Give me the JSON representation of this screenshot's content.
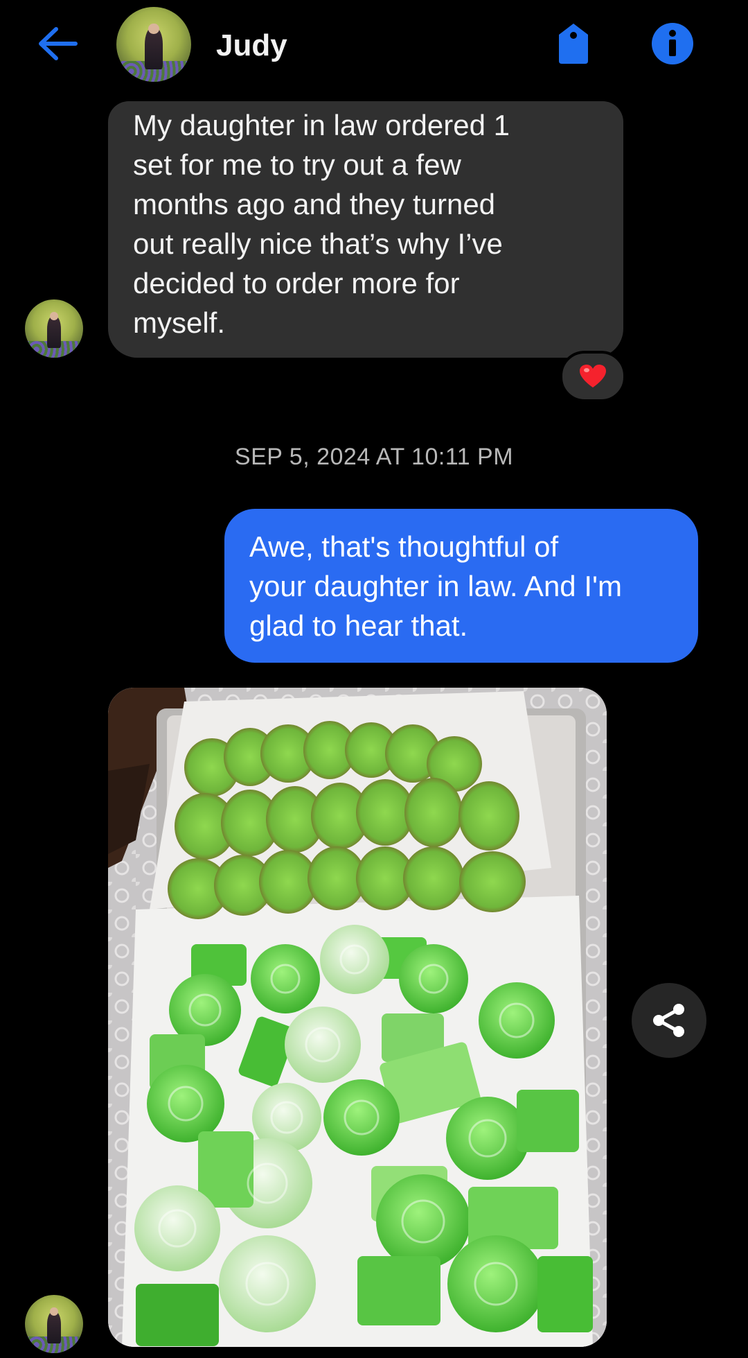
{
  "header": {
    "contact_name": "Judy",
    "accent_color": "#1877f2"
  },
  "messages": [
    {
      "direction": "received",
      "text": "My daughter in law ordered 1\nset for me to try out a few\nmonths ago and they turned\nout really nice that’s why I’ve\ndecided to order more for\nmyself.",
      "reaction": "❤️"
    },
    {
      "type": "timestamp",
      "text": "SEP 5, 2024 AT 10:11 PM"
    },
    {
      "direction": "sent",
      "text": "Awe, that's thoughtful of\nyour daughter in law. And I'm\nglad to hear that."
    },
    {
      "direction": "received",
      "type": "photo"
    }
  ],
  "icons": {
    "back": "back-arrow-icon",
    "tag": "tag-icon",
    "info": "info-icon",
    "share": "share-icon",
    "heart": "heart-icon"
  },
  "colors": {
    "background": "#000000",
    "received_bubble": "#303030",
    "sent_bubble": "#2a6bf2",
    "timestamp": "#b8b8b8"
  }
}
